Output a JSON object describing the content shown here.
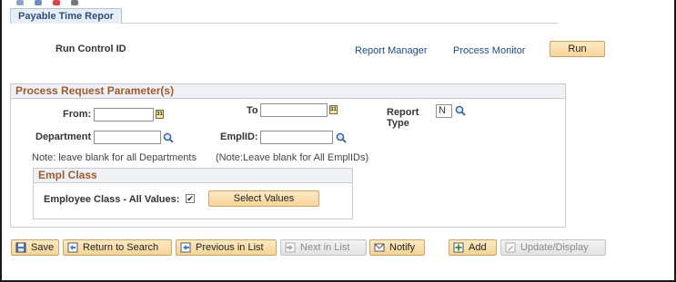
{
  "tab": {
    "label": "Payable Time Repor"
  },
  "header": {
    "run_control_label": "Run Control ID",
    "report_manager": "Report Manager",
    "process_monitor": "Process Monitor",
    "run_button": "Run"
  },
  "process_params": {
    "title": "Process Request Parameter(s)",
    "from_label": "From:",
    "from_value": "",
    "to_label": "To",
    "to_value": "",
    "report_type_label_1": "Report",
    "report_type_label_2": "Type",
    "report_type_value": "N",
    "department_label": "Department",
    "department_value": "",
    "emplid_label": "EmplID:",
    "emplid_value": "",
    "dept_note": "Note: leave blank for all Departments",
    "emplid_note": "(Note:Leave blank for All EmplIDs)",
    "calendar_glyph": "31"
  },
  "empl_class": {
    "title": "Empl Class",
    "all_values_label": "Employee Class - All Values:",
    "all_values_checked": true,
    "check_glyph": "✔",
    "select_values_button": "Select Values"
  },
  "toolbar": {
    "save": "Save",
    "return_to_search": "Return to Search",
    "previous_in_list": "Previous in List",
    "next_in_list": "Next in List",
    "notify": "Notify",
    "add": "Add",
    "update_display": "Update/Display"
  },
  "colors": {
    "accent_link": "#1d4c85",
    "group_title": "#a05a2c",
    "button_fill": "#f8d59a"
  }
}
